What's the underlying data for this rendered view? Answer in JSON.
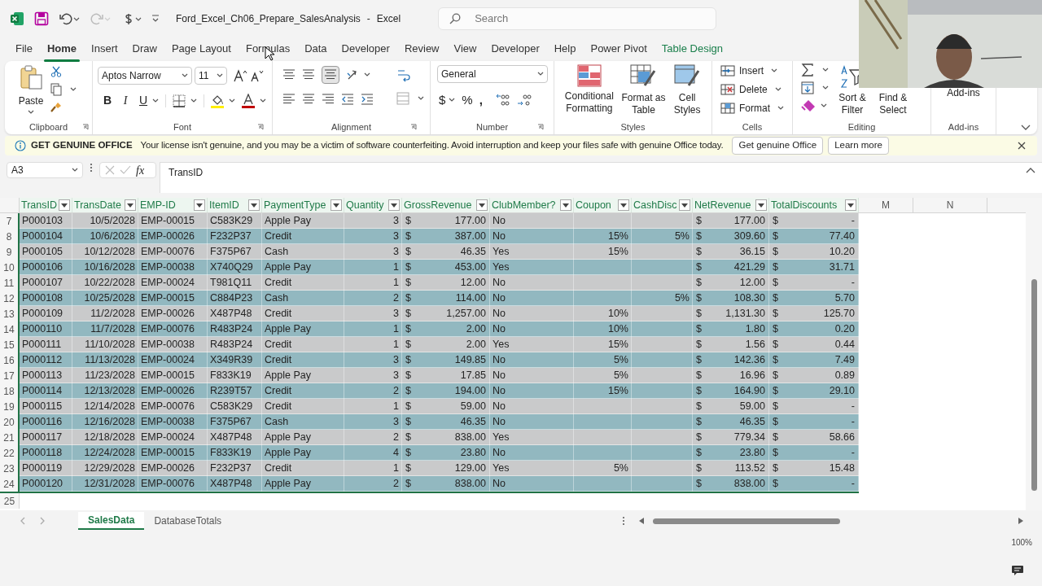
{
  "title_bar": {
    "document": "Ford_Excel_Ch06_Prepare_SalesAnalysis",
    "separator": "-",
    "app": "Excel",
    "search_placeholder": "Search"
  },
  "menu_tabs": [
    {
      "label": "File",
      "selected": false,
      "kind": "standard"
    },
    {
      "label": "Home",
      "selected": true,
      "kind": "standard"
    },
    {
      "label": "Insert",
      "selected": false,
      "kind": "standard"
    },
    {
      "label": "Draw",
      "selected": false,
      "kind": "standard"
    },
    {
      "label": "Page Layout",
      "selected": false,
      "kind": "standard"
    },
    {
      "label": "Formulas",
      "selected": false,
      "kind": "standard"
    },
    {
      "label": "Data",
      "selected": false,
      "kind": "standard"
    },
    {
      "label": "Developer",
      "selected": false,
      "kind": "standard"
    },
    {
      "label": "Review",
      "selected": false,
      "kind": "standard"
    },
    {
      "label": "View",
      "selected": false,
      "kind": "standard"
    },
    {
      "label": "Developer",
      "selected": false,
      "kind": "standard"
    },
    {
      "label": "Help",
      "selected": false,
      "kind": "standard"
    },
    {
      "label": "Power Pivot",
      "selected": false,
      "kind": "standard"
    },
    {
      "label": "Table Design",
      "selected": false,
      "kind": "contextual"
    }
  ],
  "ribbon": {
    "clipboard": {
      "paste": "Paste",
      "label": "Clipboard"
    },
    "font": {
      "name": "Aptos Narrow",
      "size": "11",
      "bold": "B",
      "italic": "I",
      "underline": "U",
      "label": "Font"
    },
    "alignment": {
      "label": "Alignment"
    },
    "number": {
      "format": "General",
      "currency": "$",
      "percent": "%",
      "comma": ",",
      "label": "Number"
    },
    "styles": {
      "buttons": [
        "Conditional Formatting",
        "Format as Table",
        "Cell Styles"
      ],
      "label": "Styles"
    },
    "cells": {
      "buttons": [
        "Insert",
        "Delete",
        "Format"
      ],
      "label": "Cells"
    },
    "editing": {
      "buttons": [
        "Sort & Filter",
        "Find & Select"
      ],
      "label": "Editing"
    },
    "add_ins": {
      "button": "Add-ins",
      "label": "Add-ins"
    }
  },
  "notification": {
    "title": "GET GENUINE OFFICE",
    "message": "Your license isn't genuine, and you may be a victim of software counterfeiting. Avoid interruption and keep your files safe with genuine Office today.",
    "buttons": [
      "Get genuine Office",
      "Learn more"
    ]
  },
  "formula_bar": {
    "name_box": "A3",
    "fx": "fx",
    "formula": "TransID"
  },
  "sheet": {
    "columns": [
      {
        "label": "TransID",
        "kind": "text"
      },
      {
        "label": "TransDate",
        "kind": "number"
      },
      {
        "label": "EMP-ID",
        "kind": "text"
      },
      {
        "label": "ItemID",
        "kind": "text"
      },
      {
        "label": "PaymentType",
        "kind": "text"
      },
      {
        "label": "Quantity",
        "kind": "number"
      },
      {
        "label": "GrossRevenue",
        "kind": "currency"
      },
      {
        "label": "ClubMember?",
        "kind": "text"
      },
      {
        "label": "Coupon",
        "kind": "number"
      },
      {
        "label": "CashDisc",
        "kind": "number"
      },
      {
        "label": "NetRevenue",
        "kind": "currency"
      },
      {
        "label": "TotalDiscounts",
        "kind": "currency"
      }
    ],
    "extra_columns": [
      "M",
      "N"
    ],
    "rows": [
      {
        "row": "7",
        "cells": [
          "P000103",
          "10/5/2028",
          "EMP-00015",
          "C583K29",
          "Apple Pay",
          "3",
          [
            "$",
            "177.00"
          ],
          "No",
          null,
          null,
          [
            "$",
            "177.00"
          ],
          [
            "$",
            "-"
          ]
        ]
      },
      {
        "row": "8",
        "cells": [
          "P000104",
          "10/6/2028",
          "EMP-00026",
          "F232P37",
          "Credit",
          "3",
          [
            "$",
            "387.00"
          ],
          "No",
          "15%",
          "5%",
          [
            "$",
            "309.60"
          ],
          [
            "$",
            "77.40"
          ]
        ]
      },
      {
        "row": "9",
        "cells": [
          "P000105",
          "10/12/2028",
          "EMP-00076",
          "F375P67",
          "Cash",
          "3",
          [
            "$",
            "46.35"
          ],
          "Yes",
          "15%",
          null,
          [
            "$",
            "36.15"
          ],
          [
            "$",
            "10.20"
          ]
        ]
      },
      {
        "row": "10",
        "cells": [
          "P000106",
          "10/16/2028",
          "EMP-00038",
          "X740Q29",
          "Apple Pay",
          "1",
          [
            "$",
            "453.00"
          ],
          "Yes",
          null,
          null,
          [
            "$",
            "421.29"
          ],
          [
            "$",
            "31.71"
          ]
        ]
      },
      {
        "row": "11",
        "cells": [
          "P000107",
          "10/22/2028",
          "EMP-00024",
          "T981Q11",
          "Credit",
          "1",
          [
            "$",
            "12.00"
          ],
          "No",
          null,
          null,
          [
            "$",
            "12.00"
          ],
          [
            "$",
            "-"
          ]
        ]
      },
      {
        "row": "12",
        "cells": [
          "P000108",
          "10/25/2028",
          "EMP-00015",
          "C884P23",
          "Cash",
          "2",
          [
            "$",
            "114.00"
          ],
          "No",
          null,
          "5%",
          [
            "$",
            "108.30"
          ],
          [
            "$",
            "5.70"
          ]
        ]
      },
      {
        "row": "13",
        "cells": [
          "P000109",
          "11/2/2028",
          "EMP-00026",
          "X487P48",
          "Credit",
          "3",
          [
            "$",
            "1,257.00"
          ],
          "No",
          "10%",
          null,
          [
            "$",
            "1,131.30"
          ],
          [
            "$",
            "125.70"
          ]
        ]
      },
      {
        "row": "14",
        "cells": [
          "P000110",
          "11/7/2028",
          "EMP-00076",
          "R483P24",
          "Apple Pay",
          "1",
          [
            "$",
            "2.00"
          ],
          "No",
          "10%",
          null,
          [
            "$",
            "1.80"
          ],
          [
            "$",
            "0.20"
          ]
        ]
      },
      {
        "row": "15",
        "cells": [
          "P000111",
          "11/10/2028",
          "EMP-00038",
          "R483P24",
          "Credit",
          "1",
          [
            "$",
            "2.00"
          ],
          "Yes",
          "15%",
          null,
          [
            "$",
            "1.56"
          ],
          [
            "$",
            "0.44"
          ]
        ]
      },
      {
        "row": "16",
        "cells": [
          "P000112",
          "11/13/2028",
          "EMP-00024",
          "X349R39",
          "Credit",
          "3",
          [
            "$",
            "149.85"
          ],
          "No",
          "5%",
          null,
          [
            "$",
            "142.36"
          ],
          [
            "$",
            "7.49"
          ]
        ]
      },
      {
        "row": "17",
        "cells": [
          "P000113",
          "11/23/2028",
          "EMP-00015",
          "F833K19",
          "Apple Pay",
          "3",
          [
            "$",
            "17.85"
          ],
          "No",
          "5%",
          null,
          [
            "$",
            "16.96"
          ],
          [
            "$",
            "0.89"
          ]
        ]
      },
      {
        "row": "18",
        "cells": [
          "P000114",
          "12/13/2028",
          "EMP-00026",
          "R239T57",
          "Credit",
          "2",
          [
            "$",
            "194.00"
          ],
          "No",
          "15%",
          null,
          [
            "$",
            "164.90"
          ],
          [
            "$",
            "29.10"
          ]
        ]
      },
      {
        "row": "19",
        "cells": [
          "P000115",
          "12/14/2028",
          "EMP-00076",
          "C583K29",
          "Credit",
          "1",
          [
            "$",
            "59.00"
          ],
          "No",
          null,
          null,
          [
            "$",
            "59.00"
          ],
          [
            "$",
            "-"
          ]
        ]
      },
      {
        "row": "20",
        "cells": [
          "P000116",
          "12/16/2028",
          "EMP-00038",
          "F375P67",
          "Cash",
          "3",
          [
            "$",
            "46.35"
          ],
          "No",
          null,
          null,
          [
            "$",
            "46.35"
          ],
          [
            "$",
            "-"
          ]
        ]
      },
      {
        "row": "21",
        "cells": [
          "P000117",
          "12/18/2028",
          "EMP-00024",
          "X487P48",
          "Apple Pay",
          "2",
          [
            "$",
            "838.00"
          ],
          "Yes",
          null,
          null,
          [
            "$",
            "779.34"
          ],
          [
            "$",
            "58.66"
          ]
        ]
      },
      {
        "row": "22",
        "cells": [
          "P000118",
          "12/24/2028",
          "EMP-00015",
          "F833K19",
          "Apple Pay",
          "4",
          [
            "$",
            "23.80"
          ],
          "No",
          null,
          null,
          [
            "$",
            "23.80"
          ],
          [
            "$",
            "-"
          ]
        ]
      },
      {
        "row": "23",
        "cells": [
          "P000119",
          "12/29/2028",
          "EMP-00026",
          "F232P37",
          "Credit",
          "1",
          [
            "$",
            "129.00"
          ],
          "Yes",
          "5%",
          null,
          [
            "$",
            "113.52"
          ],
          [
            "$",
            "15.48"
          ]
        ]
      },
      {
        "row": "24",
        "cells": [
          "P000120",
          "12/31/2028",
          "EMP-00076",
          "X487P48",
          "Apple Pay",
          "2",
          [
            "$",
            "838.00"
          ],
          "No",
          null,
          null,
          [
            "$",
            "838.00"
          ],
          [
            "$",
            "-"
          ]
        ]
      }
    ],
    "empty_rows": [
      "25"
    ]
  },
  "sheet_tabs": [
    {
      "label": "SalesData",
      "selected": true
    },
    {
      "label": "DatabaseTotals",
      "selected": false
    }
  ],
  "status_bar": {
    "zoom": "100%"
  }
}
